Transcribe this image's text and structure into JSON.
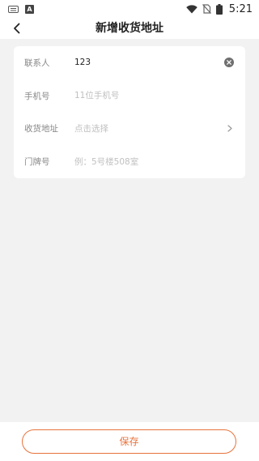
{
  "status_bar": {
    "a_badge": "A",
    "time": "5:21"
  },
  "header": {
    "title": "新增收货地址"
  },
  "form": {
    "contact": {
      "label": "联系人",
      "value": "123"
    },
    "phone": {
      "label": "手机号",
      "placeholder": "11位手机号"
    },
    "address": {
      "label": "收货地址",
      "placeholder": "点击选择"
    },
    "door": {
      "label": "门牌号",
      "placeholder": "例：5号楼508室"
    }
  },
  "footer": {
    "save_label": "保存"
  },
  "colors": {
    "accent": "#e8733c",
    "background": "#f2f2f2"
  },
  "icons": [
    "keyboard-icon",
    "a-badge-icon",
    "wifi-icon",
    "no-sim-icon",
    "battery-icon",
    "back-arrow-icon",
    "clear-icon",
    "chevron-right-icon"
  ]
}
